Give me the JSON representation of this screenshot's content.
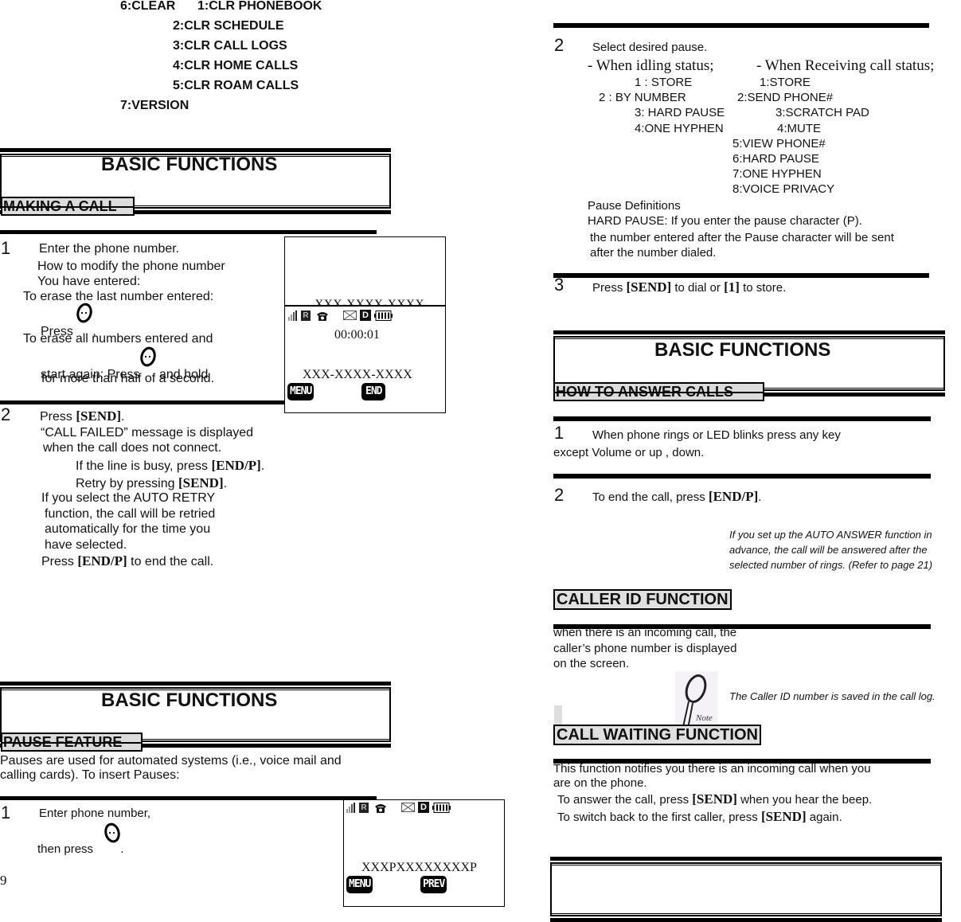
{
  "left_page": {
    "clear_menu": {
      "parent": "6:CLEAR",
      "items": [
        "1:CLR PHONEBOOK",
        "2:CLR SCHEDULE",
        "3:CLR CALL LOGS",
        "4:CLR HOME CALLS",
        "5:CLR ROAM CALLS"
      ],
      "version": "7:VERSION"
    },
    "section1": {
      "title": "BASIC FUNCTIONS",
      "subtitle": "MAKING A CALL"
    },
    "making_call": {
      "step1": {
        "num": "1",
        "lines": [
          "Enter the phone number.",
          "How to modify the phone number",
          "You have entered:",
          "To erase the last number entered:",
          "Press",
          ",",
          "To erase all numbers entered and",
          "start again: Press",
          "and hold",
          "for more than half of a second."
        ]
      },
      "step2": {
        "num": "2",
        "press": "Press",
        "send_key": "[SEND]",
        "dot": ".",
        "call_failed_1": "“CALL FAILED” message is displayed",
        "call_failed_2": "when the call does not connect.",
        "busy": "If the line is busy, press",
        "end_key": "[END/P]",
        "retry": "Retry by pressing",
        "auto_1": "If you select the AUTO RETRY",
        "auto_2": "function, the call will be retried",
        "auto_3": "automatically for the time you",
        "auto_4": "have selected.",
        "end_press": "Press",
        "end_suffix": "to end the call."
      }
    },
    "phone_display_1": {
      "top_number": "XXX-XXXX-XXXX",
      "timer": "00:00:01",
      "number": "XXX-XXXX-XXXX",
      "softkey_left": "MENU",
      "softkey_right": "END",
      "status_icons": [
        "signal-icon",
        "roaming-icon",
        "phone-icon",
        "message-icon",
        "data-icon",
        "battery-icon"
      ],
      "roaming_label": "R",
      "data_label": "D"
    },
    "section2": {
      "title": "BASIC FUNCTIONS",
      "subtitle": "PAUSE FEATURE"
    },
    "pause_intro_1": "Pauses are used for automated systems (i.e., voice mail and",
    "pause_intro_2": "calling cards). To insert Pauses:",
    "pause_step1": {
      "num": "1",
      "line1": "Enter phone number,",
      "line2": "then press",
      "line2_end": "."
    },
    "phone_display_2": {
      "number": "XXXPXXXXXXXXP",
      "softkey_left": "MENU",
      "softkey_right": "PREV",
      "roaming_label": "R",
      "data_label": "D"
    },
    "page_number": "9"
  },
  "right_page": {
    "pause_step2": {
      "num": "2",
      "title": "Select desired pause.",
      "idle_heading": "- When idling status;",
      "receiving_heading": "- When Receiving call status;",
      "idle_options": [
        "1 : STORE",
        "2 : BY NUMBER",
        "3: HARD PAUSE",
        "4:ONE HYPHEN"
      ],
      "receiving_options": [
        "1:STORE",
        "2:SEND PHONE#",
        "3:SCRATCH PAD",
        "4:MUTE",
        "5:VIEW PHONE#",
        "6:HARD PAUSE",
        "7:ONE HYPHEN",
        "8:VOICE PRIVACY"
      ],
      "def_title": "Pause Definitions",
      "def_1": "HARD PAUSE: If you enter the pause character (P).",
      "def_2": "the number entered after the Pause character will be sent",
      "def_3": "after the number dialed."
    },
    "pause_step3": {
      "num": "3",
      "press": "Press",
      "send_key": "[SEND]",
      "middle": "to dial or",
      "one_key": "[1]",
      "end": "to store."
    },
    "section3": {
      "title": "BASIC FUNCTIONS",
      "subtitle": "HOW TO ANSWER CALLS"
    },
    "answer_step1": {
      "num": "1",
      "line1": "When phone rings or LED blinks press any key",
      "line2": "except Volume or up , down."
    },
    "answer_step2": {
      "num": "2",
      "text": "To end the call, press",
      "end_key": "[END/P]",
      "dot": "."
    },
    "auto_answer_note": [
      "If you set up the AUTO ANSWER function in",
      "advance, the call will be answered after the",
      "selected number of rings. (Refer to page 21)"
    ],
    "caller_id": {
      "heading": "CALLER ID FUNCTION",
      "line1": "when there is an incoming call, the",
      "line2": "caller’s phone number is displayed",
      "line3": "on the screen.",
      "note": "The Caller ID number is saved in the call log.",
      "note_icon_label": "Note"
    },
    "call_waiting": {
      "heading": "CALL WAITING FUNCTION",
      "line1": "This function notifies you there is an incoming call when you",
      "line2": "are on the phone.",
      "line3_pre": "To answer the call, press",
      "line3_key": "[SEND]",
      "line3_post": "when you hear the beep.",
      "line4_pre": "To switch back to the first caller, press",
      "line4_key": "[SEND]",
      "line4_post": "again."
    }
  }
}
